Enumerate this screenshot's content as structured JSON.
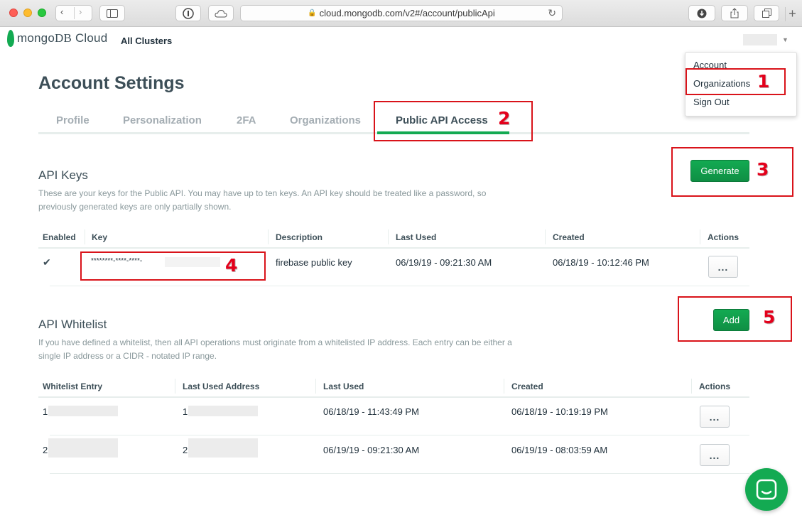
{
  "browser": {
    "url_text": "cloud.mongodb.com/v2#/account/publicApi"
  },
  "header": {
    "logo_text_1": "mongo",
    "logo_text_2": "DB",
    "logo_text_3": " Cloud",
    "nav_label": "All Clusters"
  },
  "user_menu": {
    "items": [
      "Account",
      "Organizations",
      "Sign Out"
    ]
  },
  "page": {
    "title": "Account Settings",
    "tabs": [
      "Profile",
      "Personalization",
      "2FA",
      "Organizations",
      "Public API Access"
    ],
    "active_tab": "Public API Access"
  },
  "annotations": [
    "1",
    "2",
    "3",
    "4",
    "5"
  ],
  "api_keys": {
    "title": "API Keys",
    "description_1": "These are your keys for the Public API. You may have up to ten keys. An API key should be treated like a password, so",
    "description_2": "previously generated keys are only partially shown.",
    "generate_label": "Generate",
    "columns": [
      "Enabled",
      "Key",
      "Description",
      "Last Used",
      "Created",
      "Actions"
    ],
    "rows": [
      {
        "enabled": true,
        "key": "********-****-****-",
        "description": "firebase public key",
        "last_used": "06/19/19 - 09:21:30 AM",
        "created": "06/18/19 - 10:12:46 PM",
        "actions": "..."
      }
    ]
  },
  "whitelist": {
    "title": "API Whitelist",
    "description_1": "If you have defined a whitelist, then all API operations must originate from a whitelisted IP address. Each entry can be either a",
    "description_2": "single IP address or a CIDR - notated IP range.",
    "add_label": "Add",
    "columns": [
      "Whitelist Entry",
      "Last Used Address",
      "Last Used",
      "Created",
      "Actions"
    ],
    "rows": [
      {
        "entry": "1",
        "last_used_address": "1",
        "last_used": "06/18/19 - 11:43:49 PM",
        "created": "06/18/19 - 10:19:19 PM",
        "actions": "..."
      },
      {
        "entry": "2",
        "last_used_address": "2",
        "last_used": "06/19/19 - 09:21:30 AM",
        "created": "06/19/19 - 08:03:59 AM",
        "actions": "..."
      }
    ]
  },
  "colors": {
    "accent_green": "#13aa52",
    "annotation_red": "#d9131a"
  }
}
